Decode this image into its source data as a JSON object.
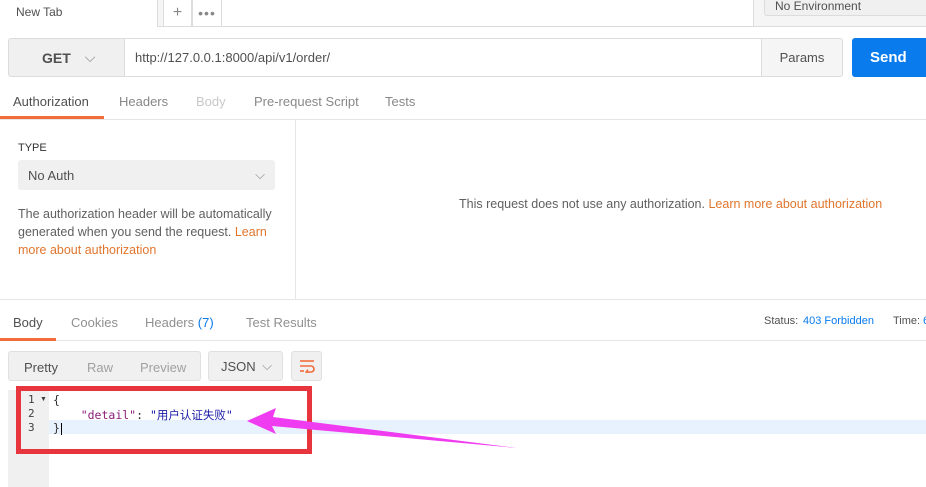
{
  "tabs": {
    "active_label": "New Tab",
    "plus_label": "+",
    "more_label": "•••"
  },
  "environment": {
    "label": "No Environment"
  },
  "request": {
    "method": "GET",
    "url": "http://127.0.0.1:8000/api/v1/order/",
    "params_label": "Params",
    "send_label": "Send"
  },
  "request_tabs": [
    "Authorization",
    "Headers",
    "Body",
    "Pre-request Script",
    "Tests"
  ],
  "auth": {
    "type_label": "TYPE",
    "type_value": "No Auth",
    "desc": "The authorization header will be automatically generated when you send the request.",
    "desc_link": "Learn more about authorization",
    "right_message": "This request does not use any authorization.",
    "right_link": "Learn more about authorization"
  },
  "response_tabs": {
    "body": "Body",
    "cookies": "Cookies",
    "headers": "Headers",
    "headers_count": "(7)",
    "test_results": "Test Results"
  },
  "status": {
    "label": "Status:",
    "value": "403 Forbidden",
    "time_label": "Time:",
    "time_value": "6"
  },
  "view": {
    "pretty": "Pretty",
    "raw": "Raw",
    "preview": "Preview",
    "format": "JSON"
  },
  "code": {
    "line_numbers": [
      "1",
      "2",
      "3"
    ],
    "line1": "{",
    "key": "\"detail\"",
    "colon": ": ",
    "value": "\"用户认证失败\"",
    "line3": "}"
  },
  "colors": {
    "accent": "#f26b3a",
    "send": "#097bed",
    "link": "#e0762e",
    "annotation_box": "#e8343c",
    "annotation_arrow": "#f03cf0"
  },
  "icons": [
    "chevron-down-icon",
    "wrap-lines-icon",
    "fold-arrow-icon",
    "annotation-arrow"
  ]
}
